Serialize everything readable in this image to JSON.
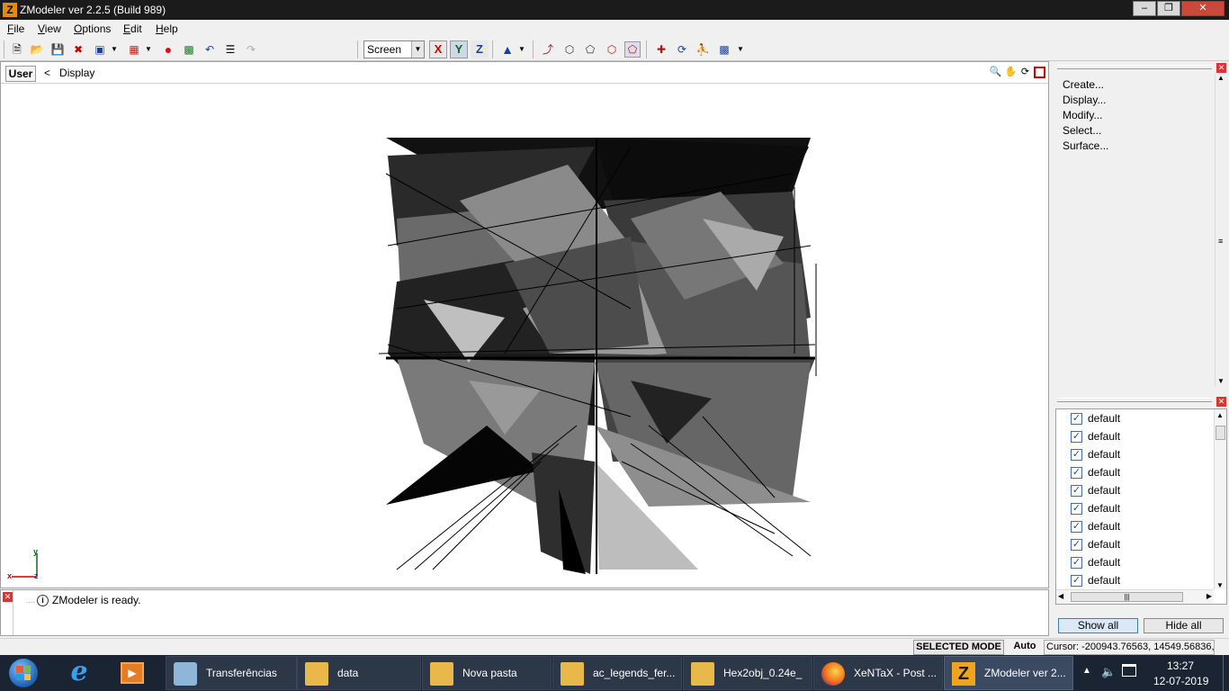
{
  "window": {
    "title": "ZModeler ver 2.2.5 (Build 989)",
    "app_icon": "Z"
  },
  "menu": [
    "File",
    "View",
    "Options",
    "Edit",
    "Help"
  ],
  "toolbar": {
    "view_select": "Screen",
    "axes": [
      "X",
      "Y",
      "Z"
    ]
  },
  "viewport": {
    "tab": "User",
    "crumb_arrow": "<",
    "crumb": "Display",
    "axis_labels": {
      "x": "x",
      "y": "y",
      "z": "z"
    }
  },
  "command_panel": {
    "items": [
      "Create...",
      "Display...",
      "Modify...",
      "Select...",
      "Surface..."
    ]
  },
  "layers": {
    "items": [
      "default",
      "default",
      "default",
      "default",
      "default",
      "default",
      "default",
      "default",
      "default",
      "default",
      "default"
    ],
    "show_all": "Show all",
    "hide_all": "Hide all"
  },
  "log": {
    "message": "ZModeler is ready.",
    "info_icon": "i"
  },
  "status": {
    "mode": "SELECTED MODE",
    "auto": "Auto",
    "cursor": "Cursor: -200943.76563, 14549.56836, (..."
  },
  "taskbar": {
    "items": [
      {
        "label": "Transferências",
        "icon": "download-folder-icon"
      },
      {
        "label": "data",
        "icon": "folder-icon"
      },
      {
        "label": "Nova pasta",
        "icon": "folder-icon"
      },
      {
        "label": "ac_legends_fer...",
        "icon": "folder-icon"
      },
      {
        "label": "Hex2obj_0.24e_",
        "icon": "folder-icon"
      },
      {
        "label": "XeNTaX - Post ...",
        "icon": "firefox-icon"
      },
      {
        "label": "ZModeler ver 2...",
        "icon": "zmodeler-icon"
      }
    ],
    "time": "13:27",
    "date": "12-07-2019"
  },
  "colors": {
    "titlebar": "#1b1b1b",
    "taskbar": "#1a2433",
    "mesh_dark": "#000000",
    "mesh_mid": "#555555",
    "mesh_light": "#bdbdbd",
    "check": "#1f4f9e"
  }
}
